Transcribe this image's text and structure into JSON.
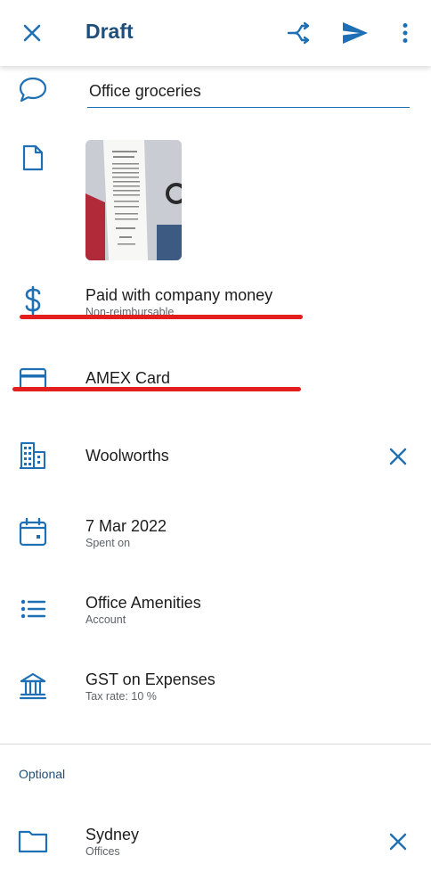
{
  "header": {
    "title": "Draft",
    "icons": {
      "close": "close-icon",
      "split": "split-icon",
      "send": "send-icon",
      "more": "more-vert-icon"
    }
  },
  "description": {
    "value": "Office groceries"
  },
  "payment": {
    "label": "Paid with company money",
    "sublabel": "Non-reimbursable"
  },
  "card": {
    "label": "AMEX Card"
  },
  "merchant": {
    "label": "Woolworths"
  },
  "date": {
    "label": "7 Mar 2022",
    "sublabel": "Spent on"
  },
  "account": {
    "label": "Office Amenities",
    "sublabel": "Account"
  },
  "tax": {
    "label": "GST on Expenses",
    "sublabel": "Tax rate: 10 %"
  },
  "optional": {
    "section_label": "Optional",
    "location": {
      "label": "Sydney",
      "sublabel": "Offices"
    }
  },
  "colors": {
    "accent": "#1f6fb5",
    "title": "#1f4e79",
    "annotation": "#e41e1e"
  }
}
